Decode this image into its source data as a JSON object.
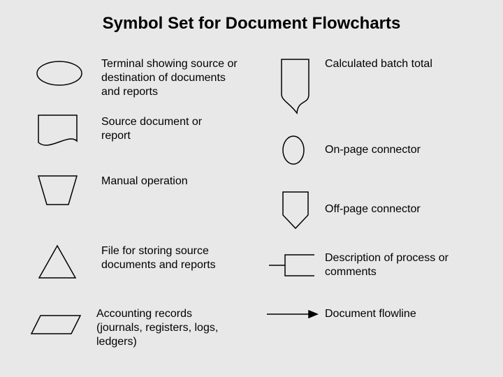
{
  "title": "Symbol Set for Document Flowcharts",
  "left": {
    "terminal": "Terminal showing source or destination of documents and reports",
    "source_doc": "Source document or report",
    "manual_op": "Manual operation",
    "file_store": "File for storing source documents and reports",
    "accounting": "Accounting records (journals, registers, logs, ledgers)"
  },
  "right": {
    "batch_total": "Calculated batch total",
    "on_page": "On-page connector",
    "off_page": "Off-page connector",
    "process_desc": "Description of process or comments",
    "flowline": "Document flowline"
  }
}
